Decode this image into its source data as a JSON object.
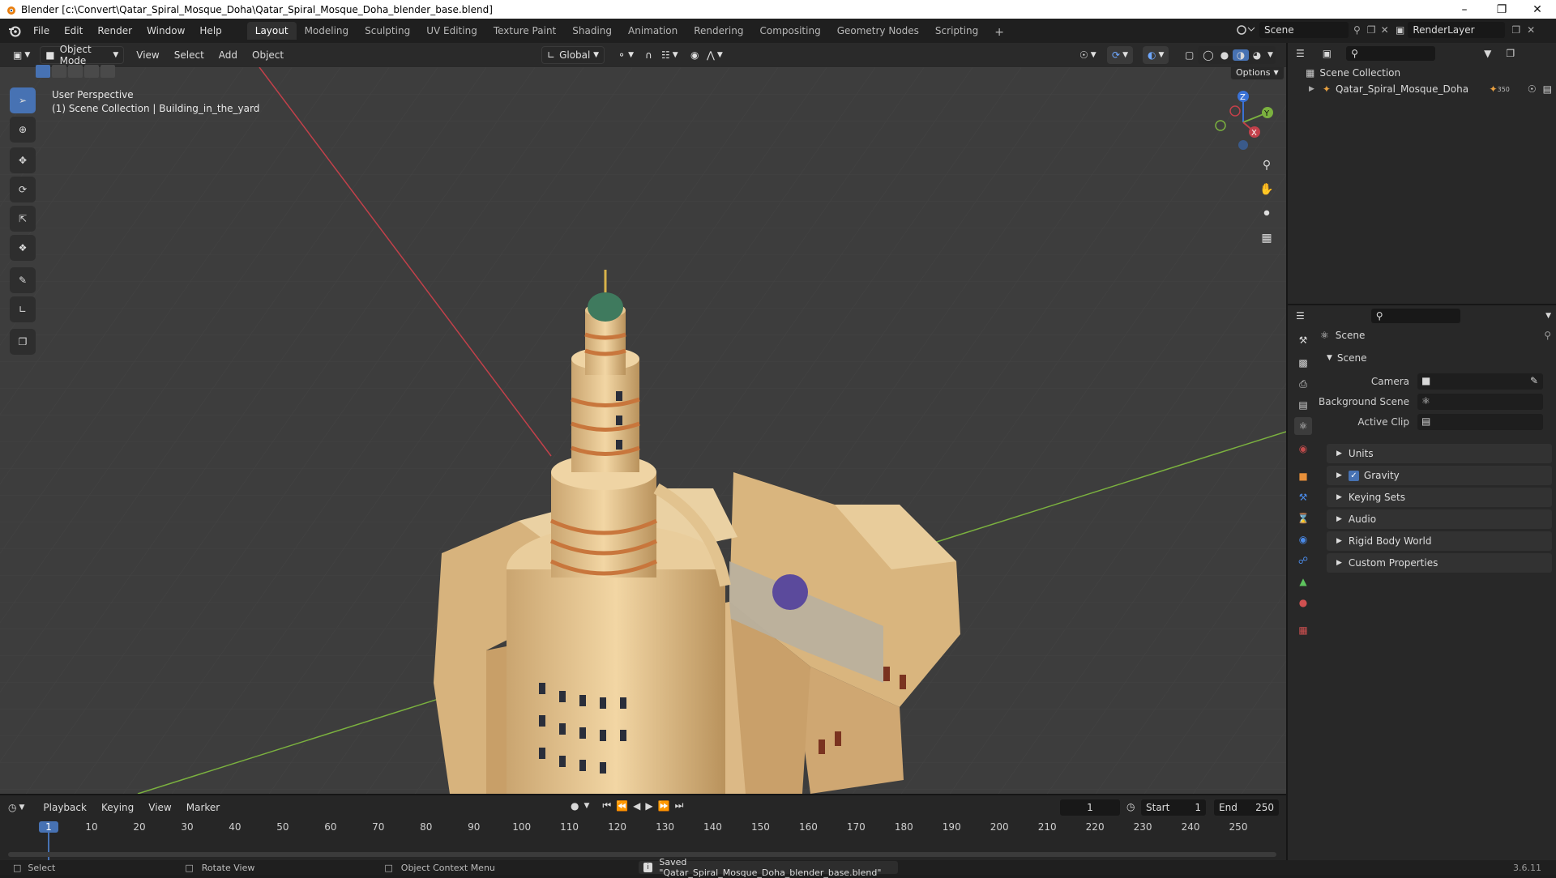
{
  "window": {
    "title": "Blender [c:\\Convert\\Qatar_Spiral_Mosque_Doha\\Qatar_Spiral_Mosque_Doha_blender_base.blend]"
  },
  "menus": [
    "File",
    "Edit",
    "Render",
    "Window",
    "Help"
  ],
  "workspaces": [
    "Layout",
    "Modeling",
    "Sculpting",
    "UV Editing",
    "Texture Paint",
    "Shading",
    "Animation",
    "Rendering",
    "Compositing",
    "Geometry Nodes",
    "Scripting"
  ],
  "active_workspace": "Layout",
  "add_workspace": "+",
  "scene_selector": {
    "value": "Scene"
  },
  "view_layer_selector": {
    "value": "RenderLayer"
  },
  "viewport_header": {
    "mode": "Object Mode",
    "menus": [
      "View",
      "Select",
      "Add",
      "Object"
    ],
    "transform_orientation": "Global",
    "options": "Options"
  },
  "viewport": {
    "perspective": "User Perspective",
    "collection_info": "(1) Scene Collection | Building_in_the_yard",
    "gizmo_axes": {
      "x": "X",
      "y": "Y",
      "z": "Z"
    }
  },
  "outliner": {
    "root": "Scene Collection",
    "items": [
      {
        "label": "Qatar_Spiral_Mosque_Doha",
        "badge": "350"
      }
    ]
  },
  "properties": {
    "context": "Scene",
    "section": "Scene",
    "fields": {
      "camera": "Camera",
      "background_scene": "Background Scene",
      "active_clip": "Active Clip"
    },
    "panels": [
      "Units",
      "Gravity",
      "Keying Sets",
      "Audio",
      "Rigid Body World",
      "Custom Properties"
    ],
    "gravity_checked": true
  },
  "timeline": {
    "menus": [
      "Playback",
      "Keying",
      "View",
      "Marker"
    ],
    "current_frame": "1",
    "start_label": "Start",
    "start": "1",
    "end_label": "End",
    "end": "250",
    "ticks": [
      "1",
      "10",
      "20",
      "30",
      "40",
      "50",
      "60",
      "70",
      "80",
      "90",
      "100",
      "110",
      "120",
      "130",
      "140",
      "150",
      "160",
      "170",
      "180",
      "190",
      "200",
      "210",
      "220",
      "230",
      "240",
      "250"
    ]
  },
  "statusbar": {
    "select": "Select",
    "rotate": "Rotate View",
    "context_menu": "Object Context Menu",
    "message": "Saved \"Qatar_Spiral_Mosque_Doha_blender_base.blend\"",
    "version": "3.6.11"
  },
  "colors": {
    "accent": "#4772b3",
    "viewport_bg": "#3d3d3d",
    "building": "#e6c690",
    "stripe": "#c8763c",
    "dome": "#3f7a5e",
    "axis_x": "#c2404a",
    "axis_y": "#7bb13f"
  }
}
